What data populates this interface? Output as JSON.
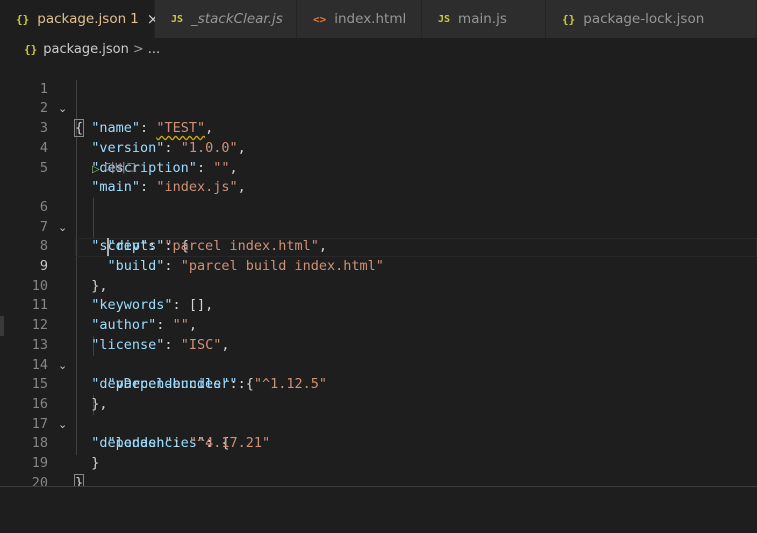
{
  "tabs": [
    {
      "icon": "{}",
      "label": "package.json",
      "modified": "1",
      "close": "×",
      "active": true
    },
    {
      "icon": "JS",
      "label": "_stackClear.js",
      "italic": true
    },
    {
      "icon": "<>",
      "label": "index.html"
    },
    {
      "icon": "JS",
      "label": "main.js"
    },
    {
      "icon": "{}",
      "label": "package-lock.json"
    }
  ],
  "breadcrumb": {
    "icon": "{}",
    "file": "package.json",
    "sep": ">",
    "more": "..."
  },
  "codelens": {
    "label": "디버그"
  },
  "lines": [
    {
      "n": "1"
    },
    {
      "n": "2"
    },
    {
      "n": "3"
    },
    {
      "n": "4"
    },
    {
      "n": "5"
    },
    {
      "n": "6"
    },
    {
      "n": "7"
    },
    {
      "n": "8"
    },
    {
      "n": "9"
    },
    {
      "n": "10"
    },
    {
      "n": "11"
    },
    {
      "n": "12"
    },
    {
      "n": "13"
    },
    {
      "n": "14"
    },
    {
      "n": "15"
    },
    {
      "n": "16"
    },
    {
      "n": "17"
    },
    {
      "n": "18"
    },
    {
      "n": "19"
    },
    {
      "n": "20"
    }
  ],
  "code": {
    "l1_open": "{",
    "l2_key": "\"name\"",
    "l2_val": "\"TEST\"",
    "l3_key": "\"version\"",
    "l3_val": "\"1.0.0\"",
    "l4_key": "\"description\"",
    "l4_val": "\"\"",
    "l5_key": "\"main\"",
    "l5_val": "\"index.js\"",
    "l6_key": "\"scripts\"",
    "l7_key": "\"dev\"",
    "l7_val": "\"parcel index.html\"",
    "l8_key": "\"build\"",
    "l8_val": "\"parcel build index.html\"",
    "l9_close": "},",
    "l10_key": "\"keywords\"",
    "l10_val": "[],",
    "l11_key": "\"author\"",
    "l11_val": "\"\"",
    "l12_key": "\"license\"",
    "l12_val": "\"ISC\"",
    "l13_key": "\"devDependencies\"",
    "l14_key": "\"parcel-bundler\"",
    "l14_val": "\"^1.12.5\"",
    "l15_close": "},",
    "l16_key": "\"dependencies\"",
    "l17_key": "\"lodash\"",
    "l17_val": "\"^4.17.21\"",
    "l18_close": "}",
    "l19_close": "}",
    "colon": ": ",
    "comma": ",",
    "open_brace": "{",
    "fold_icon": "⌄"
  },
  "colors": {
    "key": "#9cdcfe",
    "string": "#ce9178",
    "active_tab_text": "#e2c08d",
    "json_icon": "#cbcb41",
    "html_icon": "#e37933"
  }
}
